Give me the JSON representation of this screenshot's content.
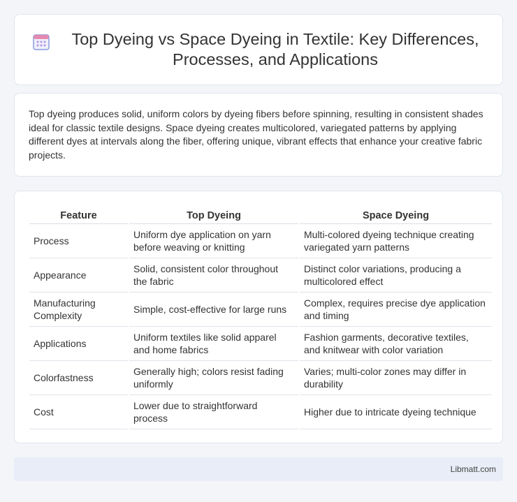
{
  "header": {
    "title": "Top Dyeing vs Space Dyeing in Textile: Key Differences, Processes, and Applications",
    "icon": "calendar-icon",
    "icon_colors": {
      "frame": "#7d8fd8",
      "top": "#e07aa6",
      "dots": "#c79be6"
    }
  },
  "intro": {
    "text": "Top dyeing produces solid, uniform colors by dyeing fibers before spinning, resulting in consistent shades ideal for classic textile designs. Space dyeing creates multicolored, variegated patterns by applying different dyes at intervals along the fiber, offering unique, vibrant effects that enhance your creative fabric projects."
  },
  "table": {
    "headers": [
      "Feature",
      "Top Dyeing",
      "Space Dyeing"
    ],
    "rows": [
      [
        "Process",
        "Uniform dye application on yarn before weaving or knitting",
        "Multi-colored dyeing technique creating variegated yarn patterns"
      ],
      [
        "Appearance",
        "Solid, consistent color throughout the fabric",
        "Distinct color variations, producing a multicolored effect"
      ],
      [
        "Manufacturing Complexity",
        "Simple, cost-effective for large runs",
        "Complex, requires precise dye application and timing"
      ],
      [
        "Applications",
        "Uniform textiles like solid apparel and home fabrics",
        "Fashion garments, decorative textiles, and knitwear with color variation"
      ],
      [
        "Colorfastness",
        "Generally high; colors resist fading uniformly",
        "Varies; multi-color zones may differ in durability"
      ],
      [
        "Cost",
        "Lower due to straightforward process",
        "Higher due to intricate dyeing technique"
      ]
    ]
  },
  "footer": {
    "text": "Libmatt.com"
  }
}
